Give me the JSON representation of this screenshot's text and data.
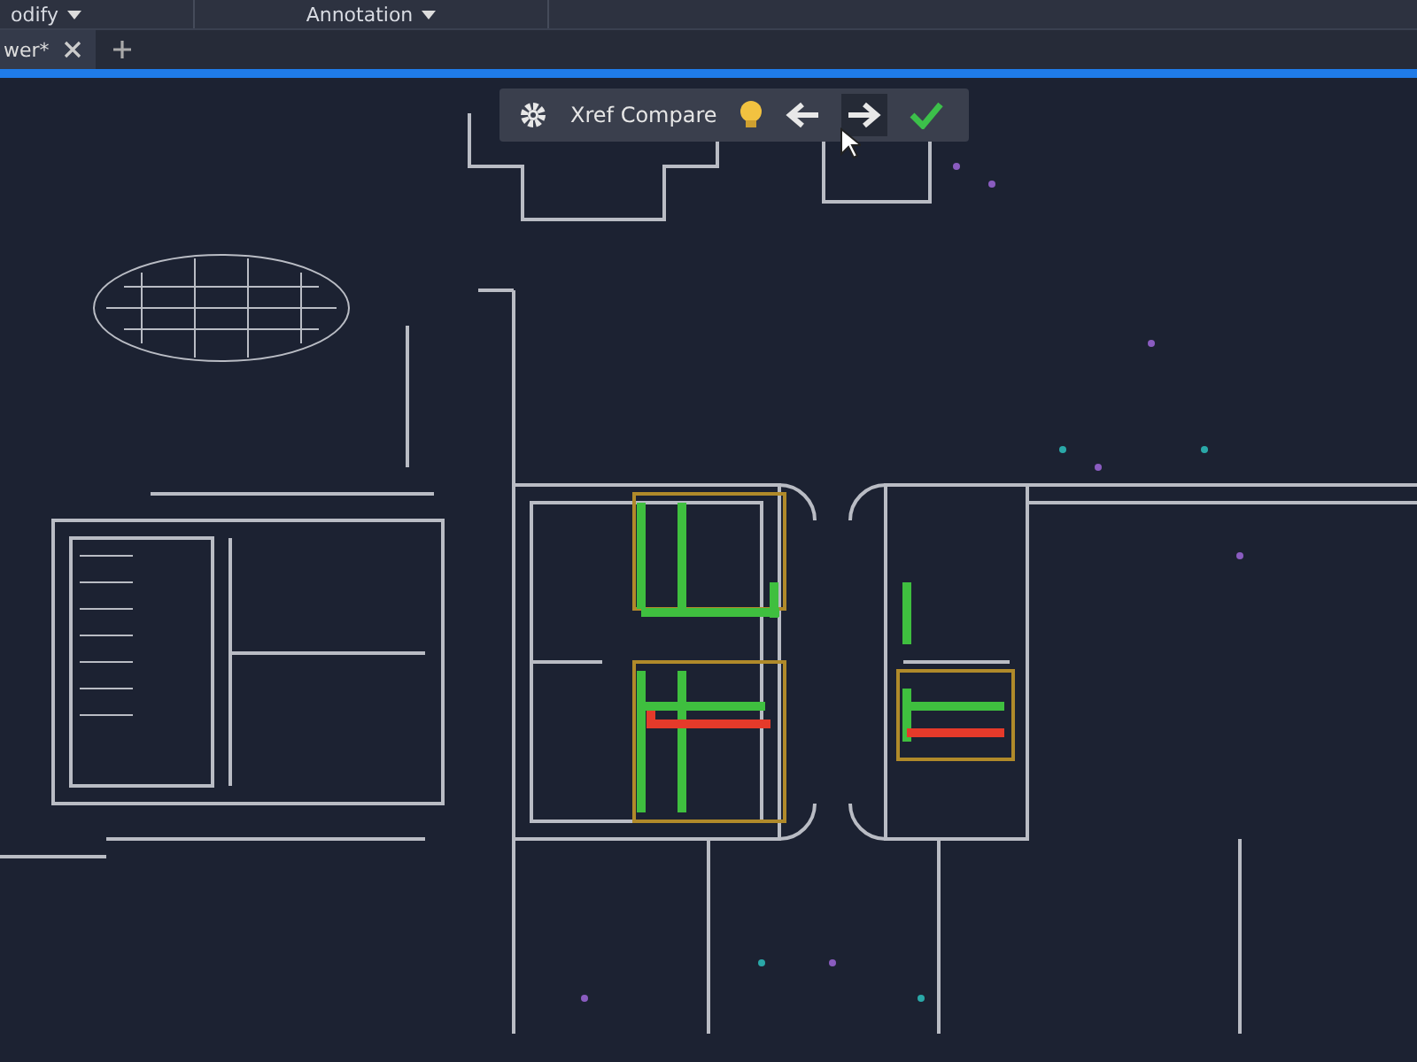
{
  "ribbon": {
    "panels": [
      {
        "label": "odify"
      },
      {
        "label": "Annotation"
      }
    ]
  },
  "file_tabs": [
    {
      "label": "wer*",
      "selected": true
    }
  ],
  "compare_toolbar": {
    "title": "Xref Compare"
  }
}
